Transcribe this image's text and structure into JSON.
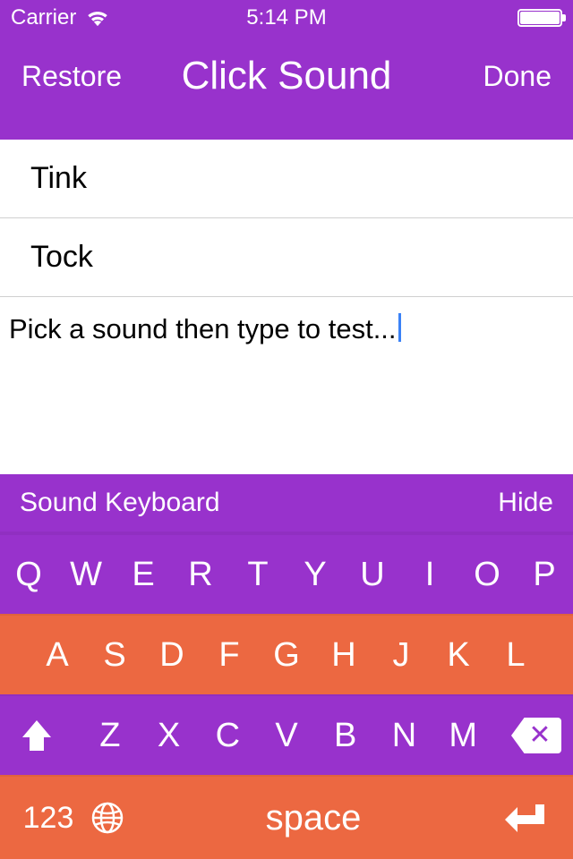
{
  "status": {
    "carrier": "Carrier",
    "time": "5:14 PM"
  },
  "navbar": {
    "left": "Restore",
    "title": "Click Sound",
    "right": "Done"
  },
  "sounds": [
    {
      "label": "Tink"
    },
    {
      "label": "Tock"
    }
  ],
  "test_placeholder": "Pick a sound then type to test...",
  "keyboard": {
    "accessory": {
      "left": "Sound Keyboard",
      "right": "Hide"
    },
    "row1": [
      "Q",
      "W",
      "E",
      "R",
      "T",
      "Y",
      "U",
      "I",
      "O",
      "P"
    ],
    "row2": [
      "A",
      "S",
      "D",
      "F",
      "G",
      "H",
      "J",
      "K",
      "L"
    ],
    "row3": [
      "Z",
      "X",
      "C",
      "V",
      "B",
      "N",
      "M"
    ],
    "numbers_label": "123",
    "space_label": "space"
  },
  "colors": {
    "purple": "#9832cc",
    "orange": "#ec6841"
  }
}
